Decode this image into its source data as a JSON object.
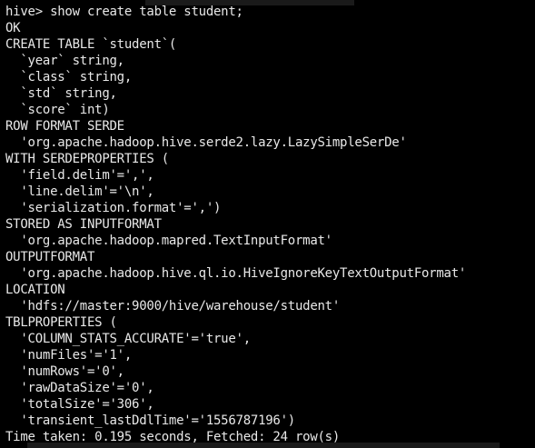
{
  "terminal": {
    "lines": [
      "hive> show create table student;",
      "OK",
      "CREATE TABLE `student`(",
      "  `year` string,",
      "  `class` string,",
      "  `std` string,",
      "  `score` int)",
      "ROW FORMAT SERDE",
      "  'org.apache.hadoop.hive.serde2.lazy.LazySimpleSerDe'",
      "WITH SERDEPROPERTIES (",
      "  'field.delim'=',',",
      "  'line.delim'='\\n',",
      "  'serialization.format'=',')",
      "STORED AS INPUTFORMAT",
      "  'org.apache.hadoop.mapred.TextInputFormat'",
      "OUTPUTFORMAT",
      "  'org.apache.hadoop.hive.ql.io.HiveIgnoreKeyTextOutputFormat'",
      "LOCATION",
      "  'hdfs://master:9000/hive/warehouse/student'",
      "TBLPROPERTIES (",
      "  'COLUMN_STATS_ACCURATE'='true',",
      "  'numFiles'='1',",
      "  'numRows'='0',",
      "  'rawDataSize'='0',",
      "  'totalSize'='306',",
      "  'transient_lastDdlTime'='1556787196')",
      "Time taken: 0.195 seconds, Fetched: 24 row(s)"
    ]
  },
  "colors": {
    "background": "#000000",
    "text": "#e8e8e8"
  }
}
